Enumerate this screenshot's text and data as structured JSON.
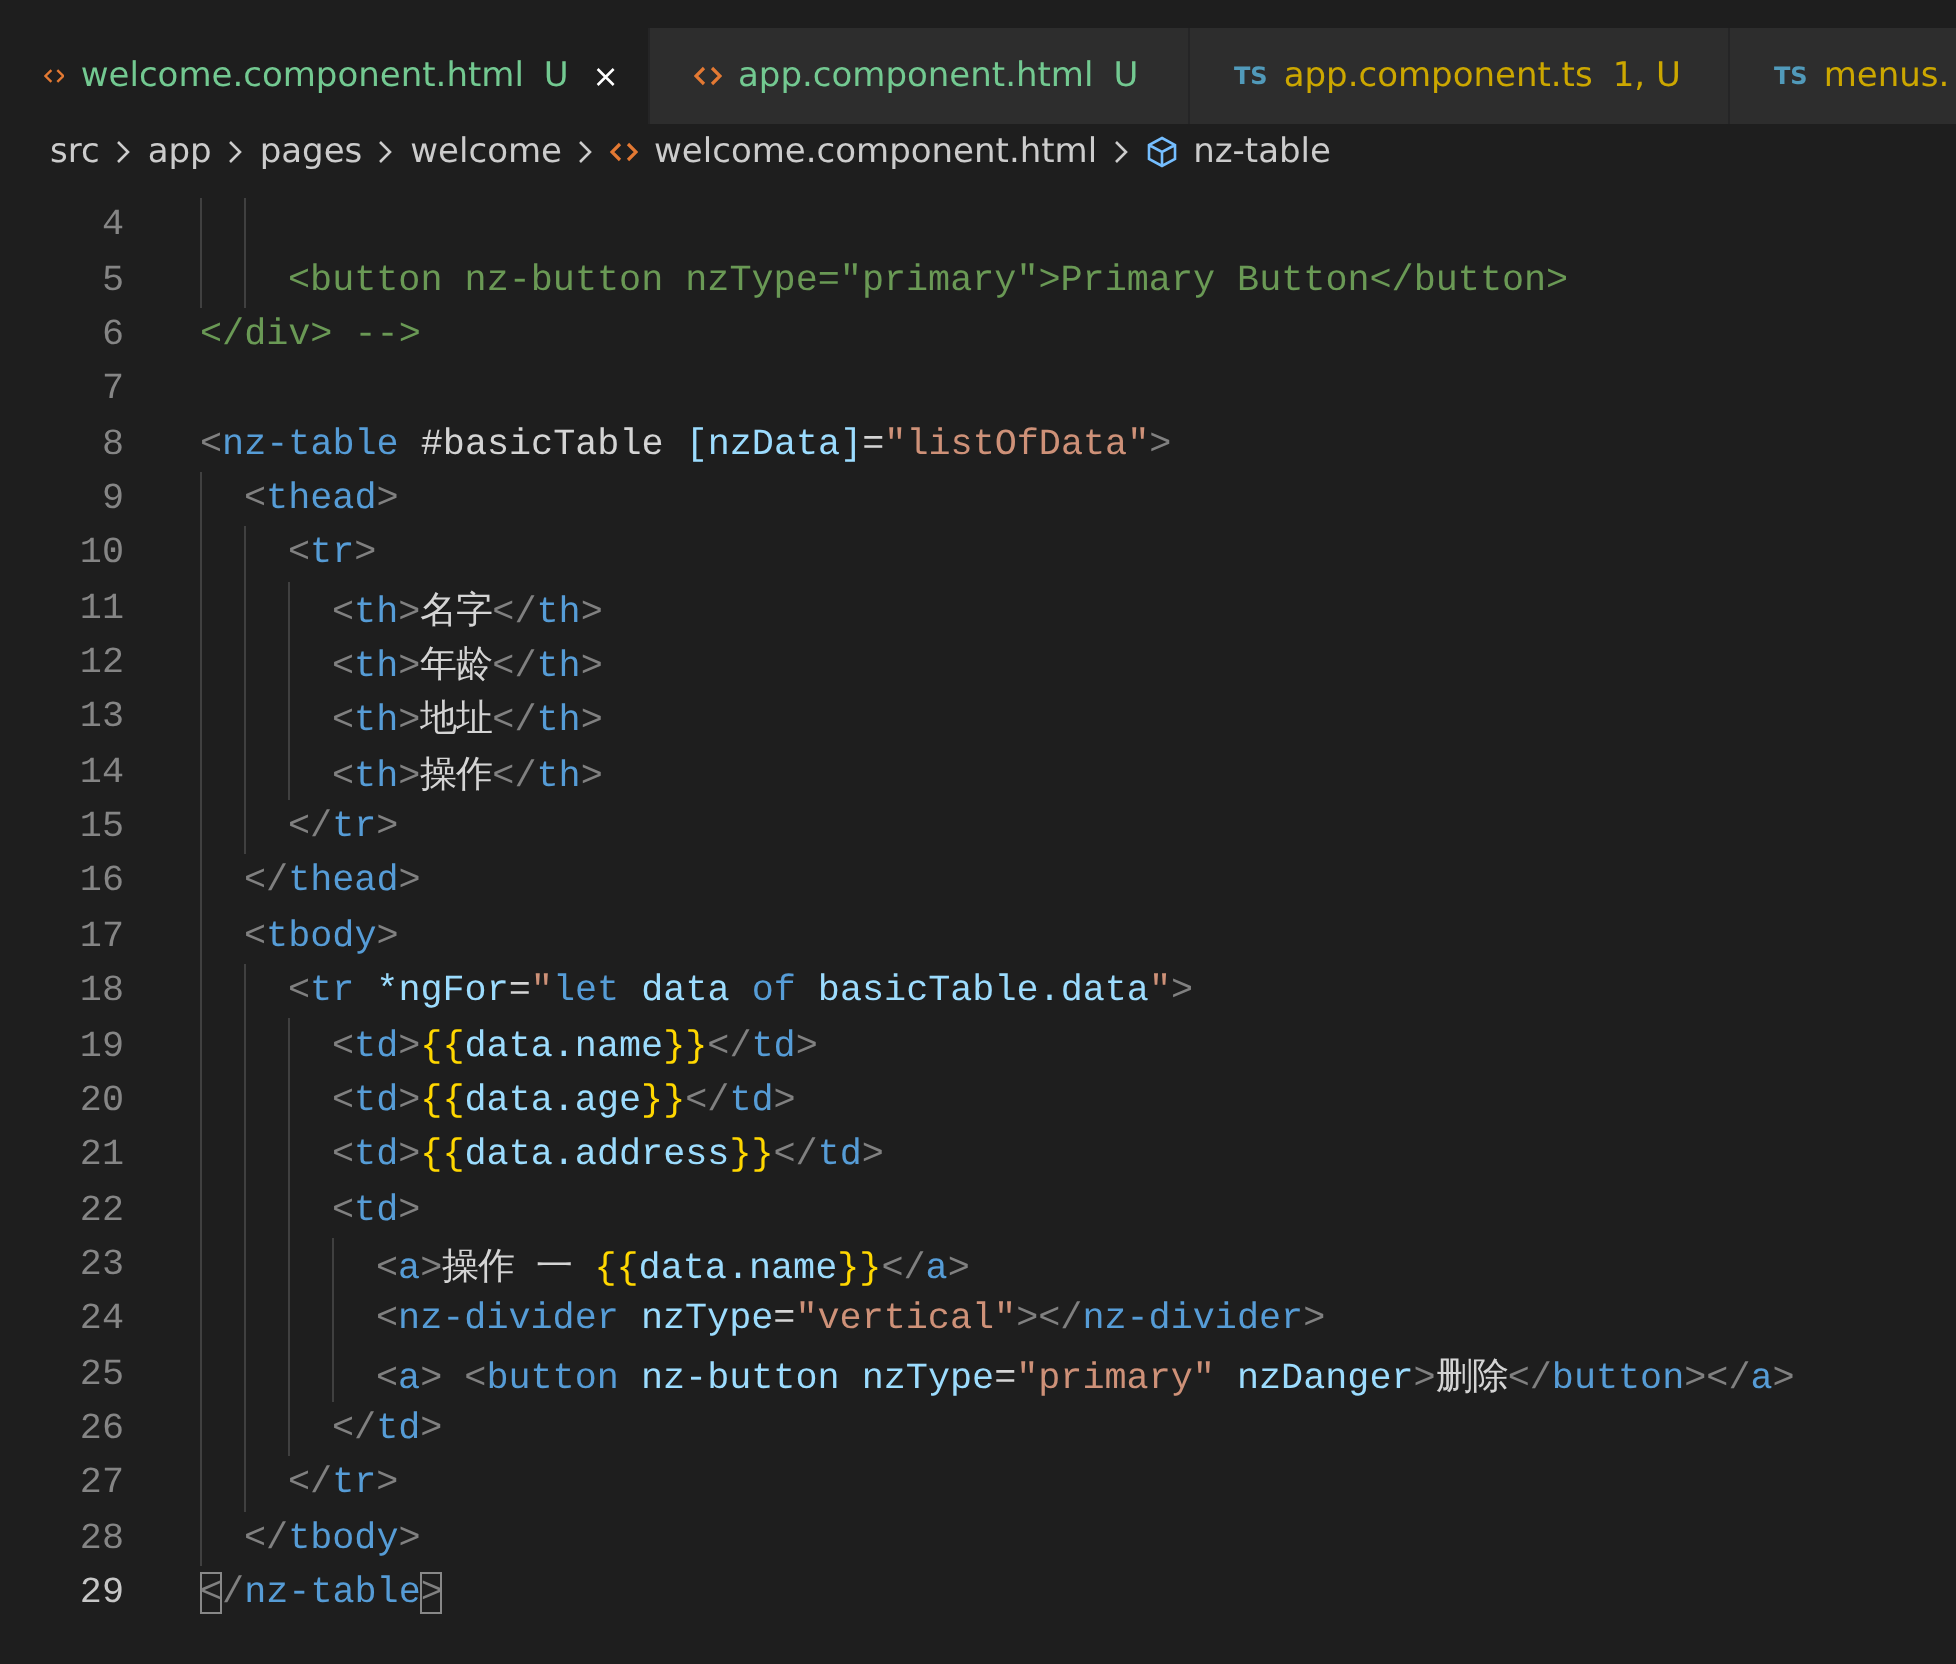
{
  "tabs": [
    {
      "label": "welcome.component.html",
      "status": "U",
      "color": "#73c991",
      "selected": true
    },
    {
      "label": "app.component.html",
      "status": "U",
      "color": "#73c991",
      "selected": false
    },
    {
      "icon_text": "TS",
      "label": "app.component.ts",
      "status": "1, U",
      "color": "#cca700",
      "selected": false
    },
    {
      "icon_text": "TS",
      "label": "menus.",
      "color": "#cca700",
      "selected": false
    }
  ],
  "breadcrumb": [
    {
      "kind": "folder",
      "label": "src"
    },
    {
      "kind": "folder",
      "label": "app"
    },
    {
      "kind": "folder",
      "label": "pages"
    },
    {
      "kind": "folder",
      "label": "welcome"
    },
    {
      "kind": "file",
      "label": "welcome.component.html"
    },
    {
      "kind": "element",
      "label": "nz-table"
    }
  ],
  "lines": [
    {
      "children": [
        {
          "children": [
            {
              "number": "4",
              "current": false
            },
            {
              "number": "5",
              "current": false,
              "tokens": [
                {
                  "kind": "comment",
                  "text": "<button nz-button nzType=\"primary\">Primary Button</button>"
                }
              ]
            }
          ]
        }
      ]
    },
    {
      "number": "6",
      "current": false,
      "tokens": [
        {
          "kind": "comment",
          "text": "</div> -->"
        }
      ]
    },
    {
      "number": "7",
      "current": false
    },
    {
      "number": "8",
      "current": false,
      "tokens": [
        {
          "kind": "punct",
          "text": "<"
        },
        {
          "kind": "tag",
          "text": "nz-table"
        },
        {
          "kind": "text",
          "text": " #basicTable "
        },
        {
          "kind": "attr",
          "text": "[nzData]"
        },
        {
          "kind": "text",
          "text": "="
        },
        {
          "kind": "string",
          "text": "\"listOfData\""
        },
        {
          "kind": "punct",
          "text": ">"
        }
      ],
      "children": [
        {
          "number": "9",
          "current": false,
          "tokens": [
            {
              "kind": "punct",
              "text": "<"
            },
            {
              "kind": "tag",
              "text": "thead"
            },
            {
              "kind": "punct",
              "text": ">"
            }
          ],
          "children": [
            {
              "number": "10",
              "current": false,
              "tokens": [
                {
                  "kind": "punct",
                  "text": "<"
                },
                {
                  "kind": "tag",
                  "text": "tr"
                },
                {
                  "kind": "punct",
                  "text": ">"
                }
              ],
              "children": [
                {
                  "number": "11",
                  "current": false,
                  "tokens": [
                    {
                      "kind": "punct",
                      "text": "<"
                    },
                    {
                      "kind": "tag",
                      "text": "th"
                    },
                    {
                      "kind": "punct",
                      "text": ">"
                    },
                    {
                      "kind": "text",
                      "text": "名字"
                    },
                    {
                      "kind": "punct",
                      "text": "</"
                    },
                    {
                      "kind": "tag",
                      "text": "th"
                    },
                    {
                      "kind": "punct",
                      "text": ">"
                    }
                  ]
                },
                {
                  "number": "12",
                  "current": false,
                  "tokens": [
                    {
                      "kind": "punct",
                      "text": "<"
                    },
                    {
                      "kind": "tag",
                      "text": "th"
                    },
                    {
                      "kind": "punct",
                      "text": ">"
                    },
                    {
                      "kind": "text",
                      "text": "年龄"
                    },
                    {
                      "kind": "punct",
                      "text": "</"
                    },
                    {
                      "kind": "tag",
                      "text": "th"
                    },
                    {
                      "kind": "punct",
                      "text": ">"
                    }
                  ]
                },
                {
                  "number": "13",
                  "current": false,
                  "tokens": [
                    {
                      "kind": "punct",
                      "text": "<"
                    },
                    {
                      "kind": "tag",
                      "text": "th"
                    },
                    {
                      "kind": "punct",
                      "text": ">"
                    },
                    {
                      "kind": "text",
                      "text": "地址"
                    },
                    {
                      "kind": "punct",
                      "text": "</"
                    },
                    {
                      "kind": "tag",
                      "text": "th"
                    },
                    {
                      "kind": "punct",
                      "text": ">"
                    }
                  ]
                },
                {
                  "number": "14",
                  "current": false,
                  "tokens": [
                    {
                      "kind": "punct",
                      "text": "<"
                    },
                    {
                      "kind": "tag",
                      "text": "th"
                    },
                    {
                      "kind": "punct",
                      "text": ">"
                    },
                    {
                      "kind": "text",
                      "text": "操作"
                    },
                    {
                      "kind": "punct",
                      "text": "</"
                    },
                    {
                      "kind": "tag",
                      "text": "th"
                    },
                    {
                      "kind": "punct",
                      "text": ">"
                    }
                  ]
                }
              ]
            },
            {
              "number": "15",
              "current": false,
              "tokens": [
                {
                  "kind": "punct",
                  "text": "</"
                },
                {
                  "kind": "tag",
                  "text": "tr"
                },
                {
                  "kind": "punct",
                  "text": ">"
                }
              ]
            }
          ]
        },
        {
          "number": "16",
          "current": false,
          "tokens": [
            {
              "kind": "punct",
              "text": "</"
            },
            {
              "kind": "tag",
              "text": "thead"
            },
            {
              "kind": "punct",
              "text": ">"
            }
          ]
        },
        {
          "number": "17",
          "current": false,
          "tokens": [
            {
              "kind": "punct",
              "text": "<"
            },
            {
              "kind": "tag",
              "text": "tbody"
            },
            {
              "kind": "punct",
              "text": ">"
            }
          ],
          "children": [
            {
              "number": "18",
              "current": false,
              "tokens": [
                {
                  "kind": "punct",
                  "text": "<"
                },
                {
                  "kind": "tag",
                  "text": "tr "
                },
                {
                  "kind": "attr",
                  "text": "*ngFor"
                },
                {
                  "kind": "text",
                  "text": "="
                },
                {
                  "kind": "string",
                  "text": "\""
                },
                {
                  "kind": "keyword",
                  "text": "let "
                },
                {
                  "kind": "attr",
                  "text": "data "
                },
                {
                  "kind": "keyword",
                  "text": "of "
                },
                {
                  "kind": "attr",
                  "text": "basicTable.data"
                },
                {
                  "kind": "string",
                  "text": "\""
                },
                {
                  "kind": "punct",
                  "text": ">"
                }
              ],
              "children": [
                {
                  "number": "19",
                  "current": false,
                  "tokens": [
                    {
                      "kind": "punct",
                      "text": "<"
                    },
                    {
                      "kind": "tag",
                      "text": "td"
                    },
                    {
                      "kind": "punct",
                      "text": ">"
                    },
                    {
                      "kind": "brace",
                      "text": "{{"
                    },
                    {
                      "kind": "attr",
                      "text": "data.name"
                    },
                    {
                      "kind": "brace",
                      "text": "}}"
                    },
                    {
                      "kind": "punct",
                      "text": "</"
                    },
                    {
                      "kind": "tag",
                      "text": "td"
                    },
                    {
                      "kind": "punct",
                      "text": ">"
                    }
                  ]
                },
                {
                  "number": "20",
                  "current": false,
                  "tokens": [
                    {
                      "kind": "punct",
                      "text": "<"
                    },
                    {
                      "kind": "tag",
                      "text": "td"
                    },
                    {
                      "kind": "punct",
                      "text": ">"
                    },
                    {
                      "kind": "brace",
                      "text": "{{"
                    },
                    {
                      "kind": "attr",
                      "text": "data.age"
                    },
                    {
                      "kind": "brace",
                      "text": "}}"
                    },
                    {
                      "kind": "punct",
                      "text": "</"
                    },
                    {
                      "kind": "tag",
                      "text": "td"
                    },
                    {
                      "kind": "punct",
                      "text": ">"
                    }
                  ]
                },
                {
                  "number": "21",
                  "current": false,
                  "tokens": [
                    {
                      "kind": "punct",
                      "text": "<"
                    },
                    {
                      "kind": "tag",
                      "text": "td"
                    },
                    {
                      "kind": "punct",
                      "text": ">"
                    },
                    {
                      "kind": "brace",
                      "text": "{{"
                    },
                    {
                      "kind": "attr",
                      "text": "data.address"
                    },
                    {
                      "kind": "brace",
                      "text": "}}"
                    },
                    {
                      "kind": "punct",
                      "text": "</"
                    },
                    {
                      "kind": "tag",
                      "text": "td"
                    },
                    {
                      "kind": "punct",
                      "text": ">"
                    }
                  ]
                },
                {
                  "number": "22",
                  "current": false,
                  "tokens": [
                    {
                      "kind": "punct",
                      "text": "<"
                    },
                    {
                      "kind": "tag",
                      "text": "td"
                    },
                    {
                      "kind": "punct",
                      "text": ">"
                    }
                  ],
                  "children": [
                    {
                      "number": "23",
                      "current": false,
                      "tokens": [
                        {
                          "kind": "punct",
                          "text": "<"
                        },
                        {
                          "kind": "tag",
                          "text": "a"
                        },
                        {
                          "kind": "punct",
                          "text": ">"
                        },
                        {
                          "kind": "text",
                          "text": "操作 一 "
                        },
                        {
                          "kind": "brace",
                          "text": "{{"
                        },
                        {
                          "kind": "attr",
                          "text": "data.name"
                        },
                        {
                          "kind": "brace",
                          "text": "}}"
                        },
                        {
                          "kind": "punct",
                          "text": "</"
                        },
                        {
                          "kind": "tag",
                          "text": "a"
                        },
                        {
                          "kind": "punct",
                          "text": ">"
                        }
                      ]
                    },
                    {
                      "number": "24",
                      "current": false,
                      "tokens": [
                        {
                          "kind": "punct",
                          "text": "<"
                        },
                        {
                          "kind": "tag",
                          "text": "nz-divider "
                        },
                        {
                          "kind": "attr",
                          "text": "nzType"
                        },
                        {
                          "kind": "text",
                          "text": "="
                        },
                        {
                          "kind": "string",
                          "text": "\"vertical\""
                        },
                        {
                          "kind": "punct",
                          "text": "></"
                        },
                        {
                          "kind": "tag",
                          "text": "nz-divider"
                        },
                        {
                          "kind": "punct",
                          "text": ">"
                        }
                      ]
                    },
                    {
                      "number": "25",
                      "current": false,
                      "tokens": [
                        {
                          "kind": "punct",
                          "text": "<"
                        },
                        {
                          "kind": "tag",
                          "text": "a"
                        },
                        {
                          "kind": "punct",
                          "text": "> <"
                        },
                        {
                          "kind": "tag",
                          "text": "button "
                        },
                        {
                          "kind": "attr",
                          "text": "nz-button nzType"
                        },
                        {
                          "kind": "text",
                          "text": "="
                        },
                        {
                          "kind": "string",
                          "text": "\"primary\" "
                        },
                        {
                          "kind": "attr",
                          "text": "nzDanger"
                        },
                        {
                          "kind": "punct",
                          "text": ">"
                        },
                        {
                          "kind": "text",
                          "text": "删除"
                        },
                        {
                          "kind": "punct",
                          "text": "</"
                        },
                        {
                          "kind": "tag",
                          "text": "button"
                        },
                        {
                          "kind": "punct",
                          "text": "></"
                        },
                        {
                          "kind": "tag",
                          "text": "a"
                        },
                        {
                          "kind": "punct",
                          "text": ">"
                        }
                      ]
                    }
                  ]
                },
                {
                  "number": "26",
                  "current": false,
                  "tokens": [
                    {
                      "kind": "punct",
                      "text": "</"
                    },
                    {
                      "kind": "tag",
                      "text": "td"
                    },
                    {
                      "kind": "punct",
                      "text": ">"
                    }
                  ]
                }
              ]
            },
            {
              "number": "27",
              "current": false,
              "tokens": [
                {
                  "kind": "punct",
                  "text": "</"
                },
                {
                  "kind": "tag",
                  "text": "tr"
                },
                {
                  "kind": "punct",
                  "text": ">"
                }
              ]
            }
          ]
        },
        {
          "number": "28",
          "current": false,
          "tokens": [
            {
              "kind": "punct",
              "text": "</"
            },
            {
              "kind": "tag",
              "text": "tbody"
            },
            {
              "kind": "punct",
              "text": ">"
            }
          ]
        }
      ]
    },
    {
      "number": "29",
      "current": true,
      "tokens": [
        {
          "kind": "match",
          "text": "<"
        },
        {
          "kind": "punct",
          "text": "/"
        },
        {
          "kind": "tag",
          "text": "nz-table"
        },
        {
          "kind": "match",
          "text": ">"
        }
      ]
    }
  ]
}
